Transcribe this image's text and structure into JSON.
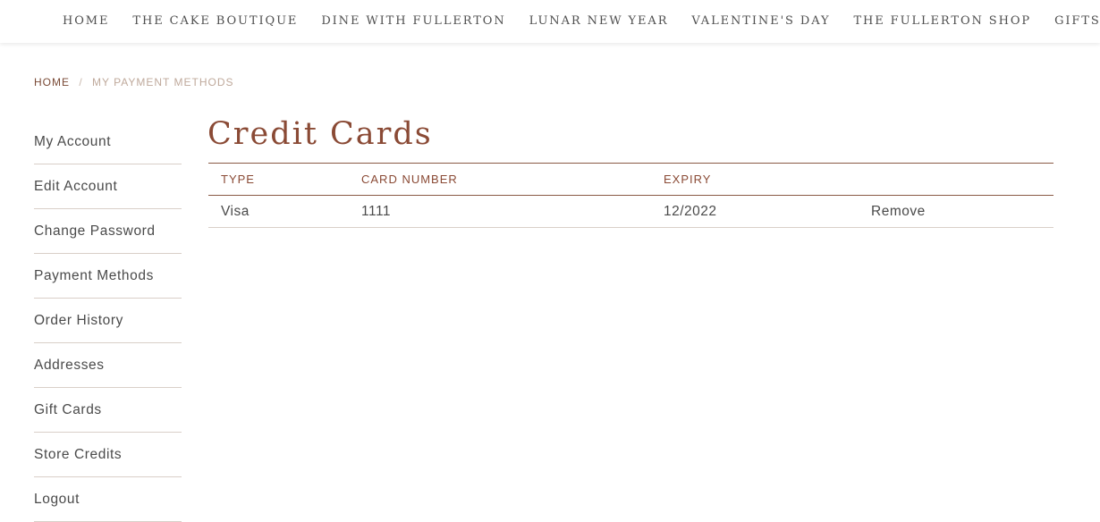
{
  "nav": {
    "items": [
      "HOME",
      "THE CAKE BOUTIQUE",
      "DINE WITH FULLERTON",
      "LUNAR NEW YEAR",
      "VALENTINE'S DAY",
      "THE FULLERTON SHOP",
      "GIFTS"
    ]
  },
  "breadcrumb": {
    "home": "HOME",
    "separator": "/",
    "current": "MY PAYMENT METHODS"
  },
  "sidebar": {
    "items": [
      "My Account",
      "Edit Account",
      "Change Password",
      "Payment Methods",
      "Order History",
      "Addresses",
      "Gift Cards",
      "Store Credits",
      "Logout"
    ]
  },
  "main": {
    "title": "Credit Cards",
    "table": {
      "headers": [
        "TYPE",
        "CARD NUMBER",
        "EXPIRY",
        ""
      ],
      "rows": [
        {
          "type": "Visa",
          "number": "1111",
          "expiry": "12/2022",
          "action": "Remove"
        }
      ]
    }
  },
  "colors": {
    "accent": "#8a4a35",
    "text": "#4a4a4a",
    "divider": "#d9cfc8"
  }
}
